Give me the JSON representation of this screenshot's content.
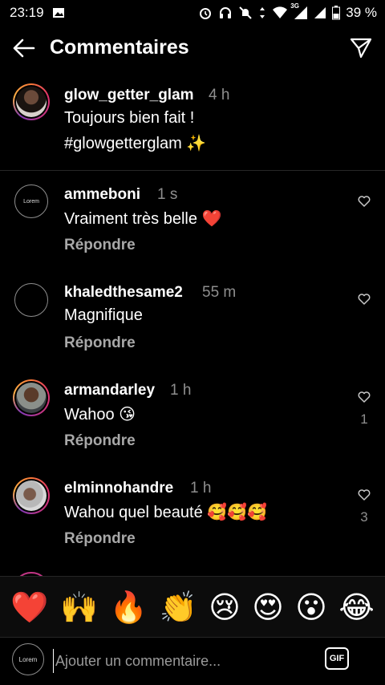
{
  "status": {
    "time": "23:19",
    "network": "3G",
    "battery": "39 %"
  },
  "header": {
    "title": "Commentaires",
    "back_icon": "back-arrow-icon",
    "send_icon": "send-icon"
  },
  "caption": {
    "username": "glow_getter_glam",
    "time": "4 h",
    "line1": "Toujours bien fait !",
    "line2": "#glowgetterglam ✨"
  },
  "comments": [
    {
      "username": "ammeboni",
      "time": "1 s",
      "text": "Vraiment très belle ❤️",
      "reply": "Répondre",
      "likes": ""
    },
    {
      "username": "khaledthesame2",
      "time": "55 m",
      "text": "Magnifique",
      "reply": "Répondre",
      "likes": ""
    },
    {
      "username": "armandarley",
      "time": "1 h",
      "text": "Wahoo 😘",
      "reply": "Répondre",
      "likes": "1"
    },
    {
      "username": "elminnohandre",
      "time": "1 h",
      "text": "Wahou quel beauté 🥰🥰🥰",
      "reply": "Répondre",
      "likes": "3"
    }
  ],
  "emojis": [
    "❤️",
    "🙌",
    "🔥",
    "👏",
    "😢",
    "😍",
    "😮",
    "😂"
  ],
  "input": {
    "placeholder": "Ajouter un commentaire...",
    "gif_label": "GIF",
    "avatar_text": "Lorem"
  },
  "colors": {
    "background": "#000000",
    "muted": "#8e8e8e",
    "divider": "#262626"
  }
}
